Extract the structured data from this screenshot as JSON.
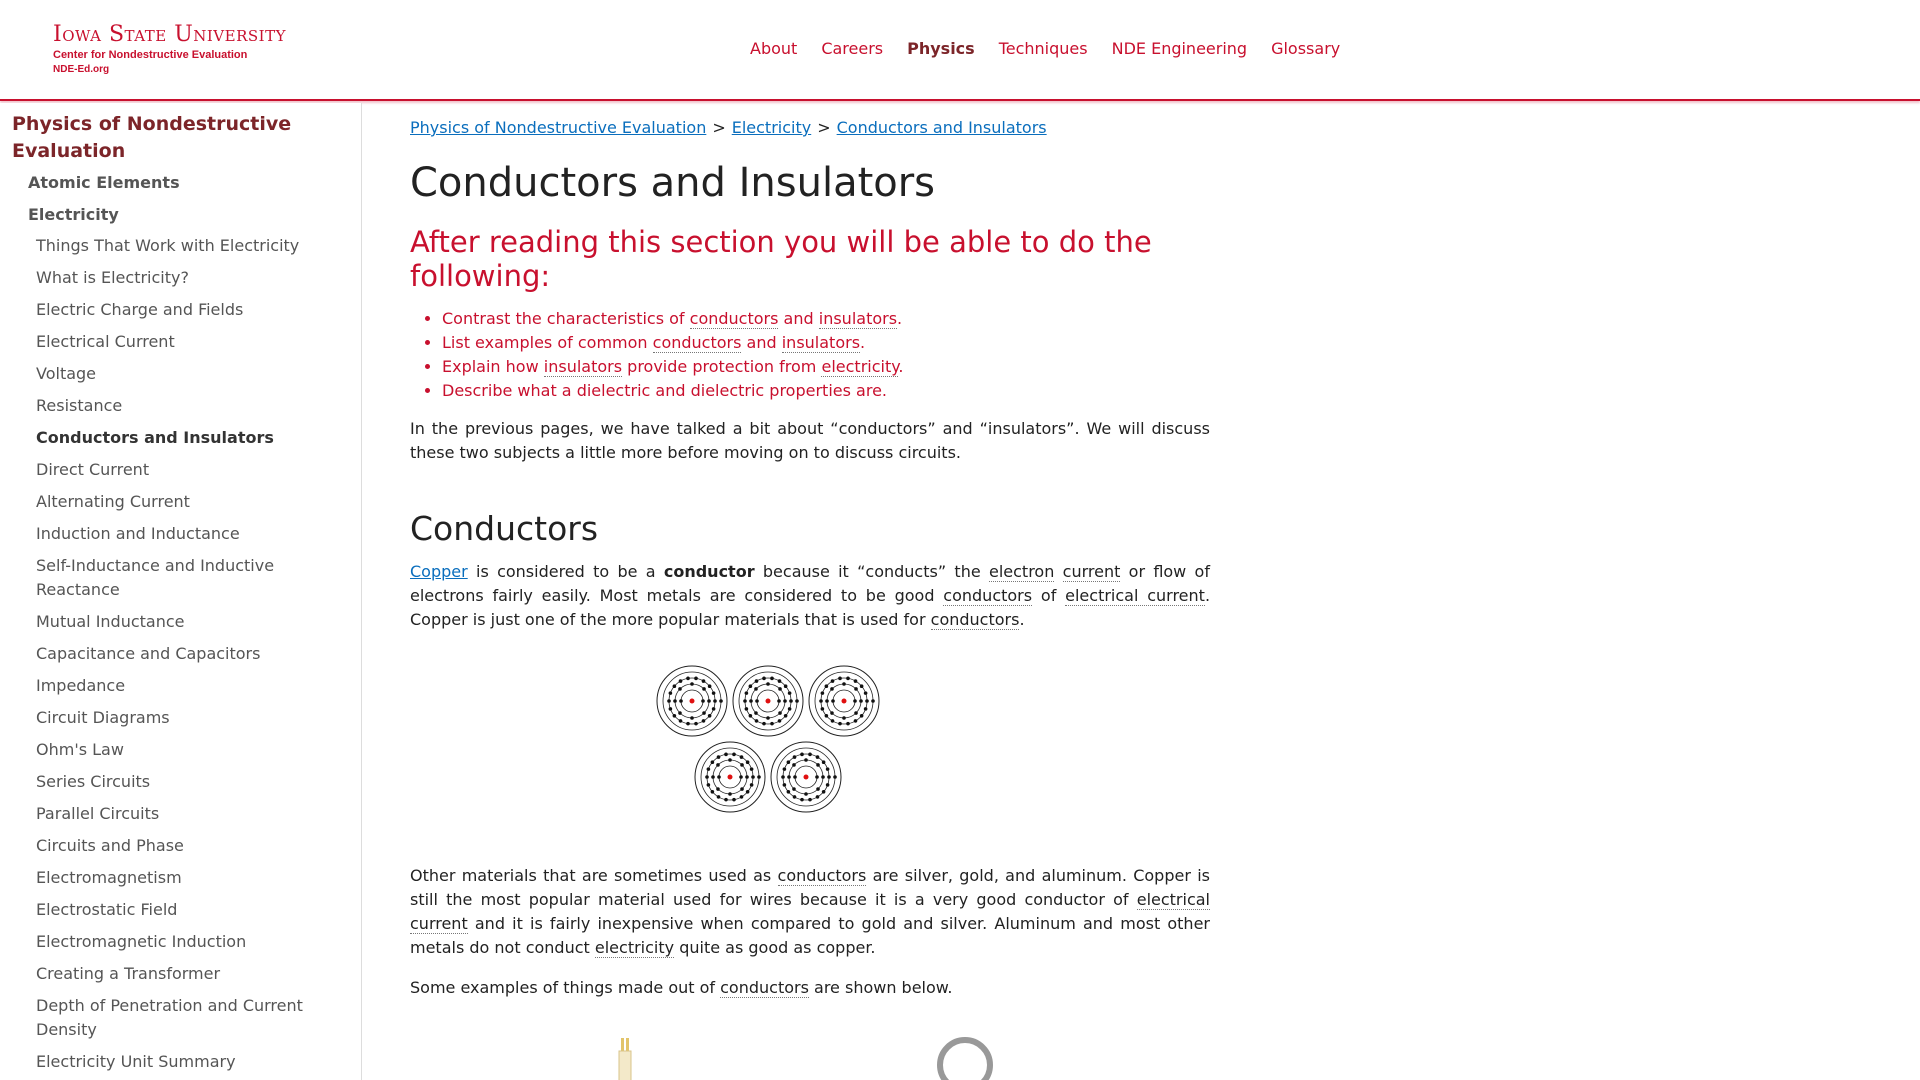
{
  "header": {
    "logo": {
      "university": "Iowa State University",
      "center": "Center for Nondestructive Evaluation",
      "site": "NDE-Ed.org"
    },
    "nav": [
      "About",
      "Careers",
      "Physics",
      "Techniques",
      "NDE Engineering",
      "Glossary"
    ],
    "active_nav": "Physics"
  },
  "sidebar": {
    "title": "Physics of Nondestructive Evaluation",
    "sections": [
      "Atomic Elements",
      "Electricity"
    ],
    "items": [
      "Things That Work with Electricity",
      "What is Electricity?",
      "Electric Charge and Fields",
      "Electrical Current",
      "Voltage",
      "Resistance",
      "Conductors and Insulators",
      "Direct Current",
      "Alternating Current",
      "Induction and Inductance",
      "Self-Inductance and Inductive Reactance",
      "Mutual Inductance",
      "Capacitance and Capacitors",
      "Impedance",
      "Circuit Diagrams",
      "Ohm's Law",
      "Series Circuits",
      "Parallel Circuits",
      "Circuits and Phase",
      "Electromagnetism",
      "Electrostatic Field",
      "Electromagnetic Induction",
      "Creating a Transformer",
      "Depth of Penetration and Current Density",
      "Electricity Unit Summary"
    ],
    "active_item": "Conductors and Insulators"
  },
  "breadcrumb": [
    "Physics of Nondestructive Evaluation",
    "Electricity",
    "Conductors and Insulators"
  ],
  "breadcrumb_sep": ">",
  "page_title": "Conductors and Insulators",
  "objectives": {
    "title": "After reading this section you will be able to do the following:",
    "words": {
      "contrast": "Contrast the characteristics of",
      "and": "and",
      "list": "List examples of common",
      "explain": "Explain how",
      "provide": "provide protection from",
      "describe": "Describe what a dielectric and dielectric properties are.",
      "conductors": "conductors",
      "insulators": "insulators",
      "electricity": "electricity",
      "period": "."
    }
  },
  "intro": "In the previous pages, we have talked a bit about “conductors” and “insulators”. We will discuss these two subjects a little more before moving on to discuss circuits.",
  "conductors_section": {
    "title": "Conductors",
    "p1": {
      "copper": "Copper",
      "t1": "is considered to be a",
      "conductor": "conductor",
      "t2": "because it “conducts” the",
      "electron": "electron",
      "current": "current",
      "t3": "or flow of electrons fairly easily. Most metals are considered to be good",
      "conductors": "conductors",
      "of": "of",
      "electrical_current": "electrical current",
      "t4": ". Copper is just one of the more popular materials that is used for",
      "period": "."
    },
    "p2": {
      "t1": "Other materials that are sometimes used as",
      "conductors": "conductors",
      "t2": "are silver, gold, and aluminum. Copper is still the most popular material used for wires because it is a very good conductor of",
      "electrical_current": "electrical current",
      "t3": "and it is fairly inexpensive when compared to gold and silver. Aluminum and most other metals do not conduct",
      "electricity": "electricity",
      "t4": "quite as good as copper."
    },
    "p3": {
      "t1": "Some examples of things made out of",
      "conductors": "conductors",
      "t2": "are shown below."
    }
  },
  "colors": {
    "brand_red": "#c8102e",
    "dark_red": "#7c2529",
    "link_blue": "#0a6ebd"
  }
}
